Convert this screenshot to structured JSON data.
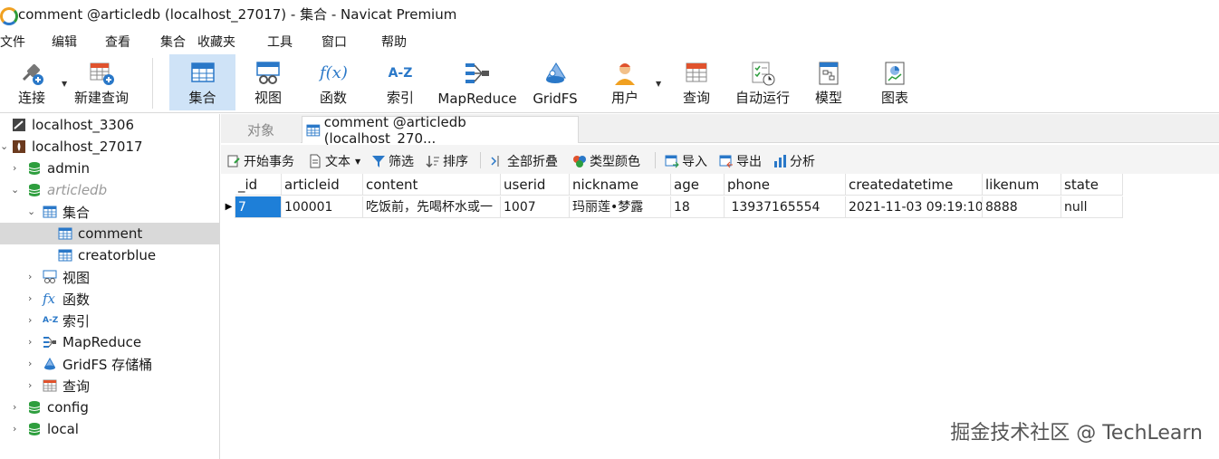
{
  "window": {
    "title": "comment @articledb (localhost_27017) - 集合 - Navicat Premium"
  },
  "menu": [
    "文件",
    "编辑",
    "查看",
    "集合",
    "收藏夹",
    "工具",
    "窗口",
    "帮助"
  ],
  "toolbar": {
    "connect": "连接",
    "new_query": "新建查询",
    "collection": "集合",
    "view": "视图",
    "function": "函数",
    "index": "索引",
    "mapreduce": "MapReduce",
    "gridfs": "GridFS",
    "user": "用户",
    "query": "查询",
    "autorun": "自动运行",
    "model": "模型",
    "chart": "图表",
    "index_icon_text": "A-Z",
    "function_icon_text": "f(x)"
  },
  "sidebar": {
    "conn1": "localhost_3306",
    "conn2": "localhost_27017",
    "db_admin": "admin",
    "db_articledb": "articledb",
    "collections": "集合",
    "coll_comment": "comment",
    "coll_creatorblue": "creatorblue",
    "views": "视图",
    "functions": "函数",
    "indexes": "索引",
    "mapreduce": "MapReduce",
    "gridfs": "GridFS 存储桶",
    "queries": "查询",
    "db_config": "config",
    "db_local": "local",
    "fx_text": "fx",
    "az_text": "A-Z"
  },
  "tabs": {
    "objects": "对象",
    "active": "comment @articledb (localhost_270..."
  },
  "objbar": {
    "begin_tx": "开始事务",
    "text": "文本",
    "filter": "筛选",
    "sort": "排序",
    "collapse_all": "全部折叠",
    "type_color": "类型颜色",
    "import": "导入",
    "export": "导出",
    "analyze": "分析"
  },
  "grid": {
    "columns": [
      "_id",
      "articleid",
      "content",
      "userid",
      "nickname",
      "age",
      "phone",
      "createdatetime",
      "likenum",
      "state"
    ],
    "rows": [
      [
        "7",
        "100001",
        "吃饭前，先喝杯水或一",
        "1007",
        "玛丽莲•梦露",
        "18",
        " 13937165554",
        "2021-11-03 09:19:10",
        "8888",
        "null"
      ]
    ]
  },
  "watermark": "掘金技术社区 @ TechLearn",
  "colors": {
    "selection": "#1e7fd8",
    "active_tool": "#cfe3f7",
    "db_green": "#2e9e3e"
  }
}
